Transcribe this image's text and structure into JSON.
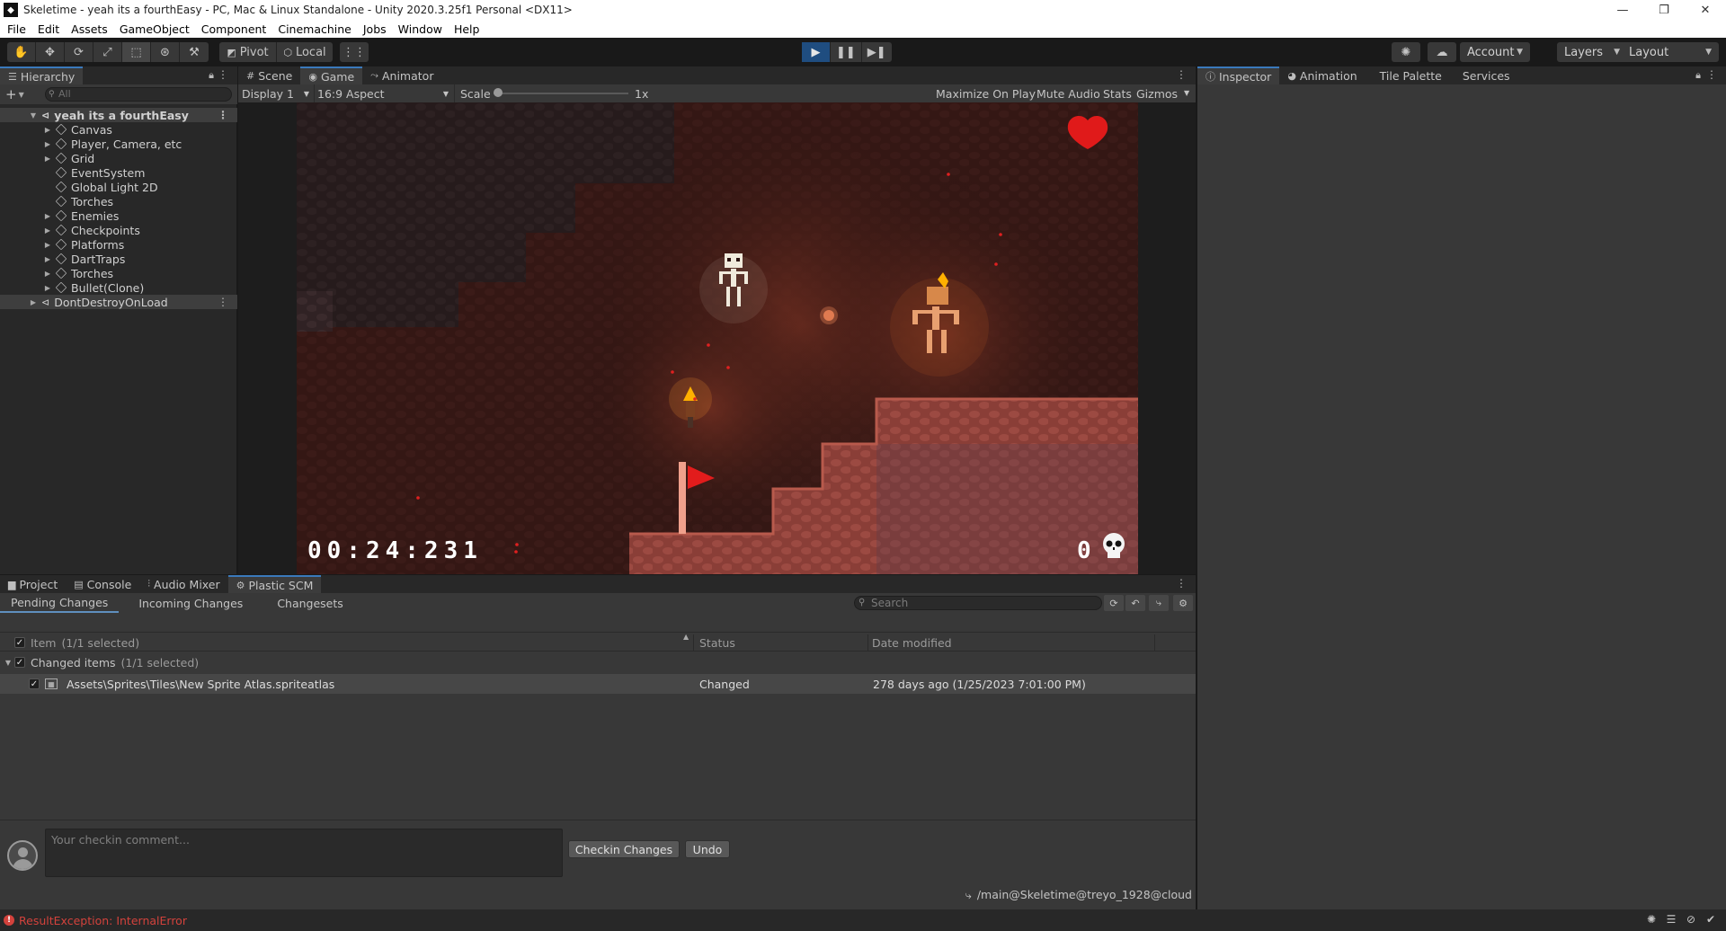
{
  "window": {
    "title": "Skeletime - yeah its a fourthEasy - PC, Mac & Linux Standalone - Unity 2020.3.25f1 Personal <DX11>",
    "minimize": "—",
    "maximize": "❐",
    "close": "✕"
  },
  "menu": [
    "File",
    "Edit",
    "Assets",
    "GameObject",
    "Component",
    "Cinemachine",
    "Jobs",
    "Window",
    "Help"
  ],
  "toolbar": {
    "tools": [
      "hand-tool-icon",
      "move-tool-icon",
      "rotate-tool-icon",
      "scale-tool-icon",
      "rect-tool-icon",
      "transform-tool-icon",
      "custom-tool-icon"
    ],
    "pivot_label": "Pivot",
    "local_label": "Local",
    "account_label": "Account",
    "layers_label": "Layers",
    "layout_label": "Layout"
  },
  "hierarchy": {
    "tab_label": "Hierarchy",
    "search_placeholder": "All",
    "scene_name": "yeah its a fourthEasy",
    "items": [
      {
        "label": "Canvas",
        "expandable": true
      },
      {
        "label": "Player, Camera, etc",
        "expandable": true
      },
      {
        "label": "Grid",
        "expandable": true
      },
      {
        "label": "EventSystem",
        "expandable": false
      },
      {
        "label": "Global Light 2D",
        "expandable": false
      },
      {
        "label": "Torches",
        "expandable": false
      },
      {
        "label": "Enemies",
        "expandable": true
      },
      {
        "label": "Checkpoints",
        "expandable": true
      },
      {
        "label": "Platforms",
        "expandable": true
      },
      {
        "label": "DartTraps",
        "expandable": true
      },
      {
        "label": "Torches",
        "expandable": true
      },
      {
        "label": "Bullet(Clone)",
        "expandable": true
      }
    ],
    "ddol_label": "DontDestroyOnLoad"
  },
  "game_panel": {
    "tabs": [
      {
        "label": "Scene",
        "icon": "#"
      },
      {
        "label": "Game",
        "icon": "◉"
      },
      {
        "label": "Animator",
        "icon": "⤳"
      }
    ],
    "display": "Display 1",
    "aspect": "16:9 Aspect",
    "scale_label": "Scale",
    "scale_value": "1x",
    "maximize": "Maximize On Play",
    "mute": "Mute Audio",
    "stats": "Stats",
    "gizmos": "Gizmos"
  },
  "game_hud": {
    "timer": "00:24:231",
    "deaths": "0"
  },
  "inspector_panel": {
    "tabs": [
      {
        "label": "Inspector",
        "icon": "ⓘ"
      },
      {
        "label": "Animation",
        "icon": "◕"
      },
      {
        "label": "Tile Palette",
        "icon": ""
      },
      {
        "label": "Services",
        "icon": ""
      }
    ]
  },
  "bottom_panel": {
    "tabs": [
      {
        "label": "Project",
        "icon": "▆"
      },
      {
        "label": "Console",
        "icon": "▤"
      },
      {
        "label": "Audio Mixer",
        "icon": "⫶"
      },
      {
        "label": "Plastic SCM",
        "icon": "⚙"
      }
    ],
    "scm_tabs": [
      "Pending Changes",
      "Incoming Changes",
      "Changesets"
    ],
    "search_placeholder": "Search",
    "columns": {
      "item": "Item",
      "item_sel": "(1/1 selected)",
      "status": "Status",
      "date": "Date modified"
    },
    "group": {
      "label": "Changed items",
      "sel": "(1/1 selected)"
    },
    "rows": [
      {
        "path": "Assets\\Sprites\\Tiles\\New Sprite Atlas.spriteatlas",
        "status": "Changed",
        "date": "278 days ago (1/25/2023 7:01:00 PM)"
      }
    ],
    "comment_placeholder": "Your checkin comment...",
    "checkin_label": "Checkin Changes",
    "undo_label": "Undo",
    "branch": "/main@Skeletime@treyo_1928@cloud"
  },
  "status": {
    "error": "ResultException: InternalError"
  },
  "colors": {
    "accent": "#3a79bb",
    "play": "#1f4d80",
    "error": "#d3423c"
  }
}
